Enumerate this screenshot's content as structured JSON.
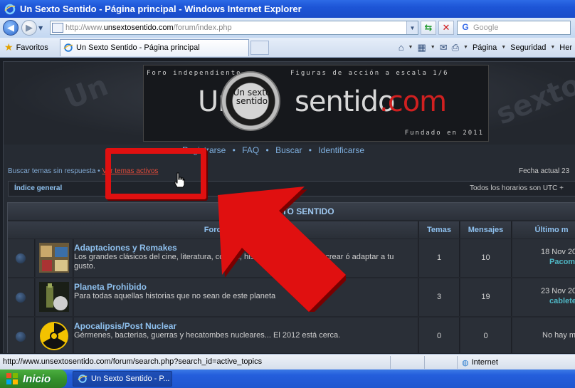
{
  "window": {
    "title": "Un Sexto Sentido - Página principal - Windows Internet Explorer"
  },
  "address": {
    "url_prefix": "http://www.",
    "url_domain": "unsextosentido.com",
    "url_path": "/forum/index.php",
    "search_placeholder": "Google"
  },
  "tabs": {
    "favorites_label": "Favoritos",
    "active_tab": "Un Sexto Sentido - Página principal"
  },
  "commandbar": {
    "page_label": "Página",
    "security_label": "Seguridad",
    "tools_label": "Her"
  },
  "banner": {
    "top_left": "Foro independiente",
    "top_right": "Figuras de acción a escala 1/6",
    "bottom_right": "Fundado en 2011",
    "logo_left": "Un",
    "logo_middle": "sentido",
    "logo_right": ".com",
    "seal_text": "Un sexto sentido"
  },
  "nav": {
    "register": "Registrarse",
    "faq": "FAQ",
    "search": "Buscar",
    "login": "Identificarse",
    "separator": "•"
  },
  "subnav": {
    "unanswered": "Buscar temas sin respuesta",
    "separator": "•",
    "active_topics": "Ver temas activos",
    "current_date": "Fecha actual 23"
  },
  "indexbar": {
    "home": "Índice general",
    "timezone": "Todos los horarios son UTC +"
  },
  "forum": {
    "category": "SEXTO SENTIDO",
    "columns": {
      "forum": "Foro",
      "topics": "Temas",
      "posts": "Mensajes",
      "last_post": "Último m"
    },
    "rows": [
      {
        "title": "Adaptaciones y Remakes",
        "desc": "Los grandes clásicos del cine, literatura, comics, historias que quieras recrear ó adaptar a tu gusto.",
        "topics": "1",
        "posts": "10",
        "last_date": "18 Nov 20",
        "last_user": "Pacom"
      },
      {
        "title": "Planeta Prohibido",
        "desc": "Para todas aquellas historias que no sean de este planeta",
        "topics": "3",
        "posts": "19",
        "last_date": "23 Nov 20",
        "last_user": "cablete"
      },
      {
        "title": "Apocalipsis/Post Nuclear",
        "desc": "Gérmenes, bacterias, guerras y hecatombes nucleares... El 2012 está cerca.",
        "topics": "0",
        "posts": "0",
        "last_none": "No hay m"
      }
    ]
  },
  "statusbar": {
    "url": "http://www.unsextosentido.com/forum/search.php?search_id=active_topics",
    "zone": "Internet"
  },
  "taskbar": {
    "start": "Inicio",
    "item": "Un Sexto Sentido - P..."
  },
  "colors": {
    "accent_red": "#e01010",
    "link_blue": "#8ec0ee",
    "user_teal": "#4fb6c4"
  }
}
